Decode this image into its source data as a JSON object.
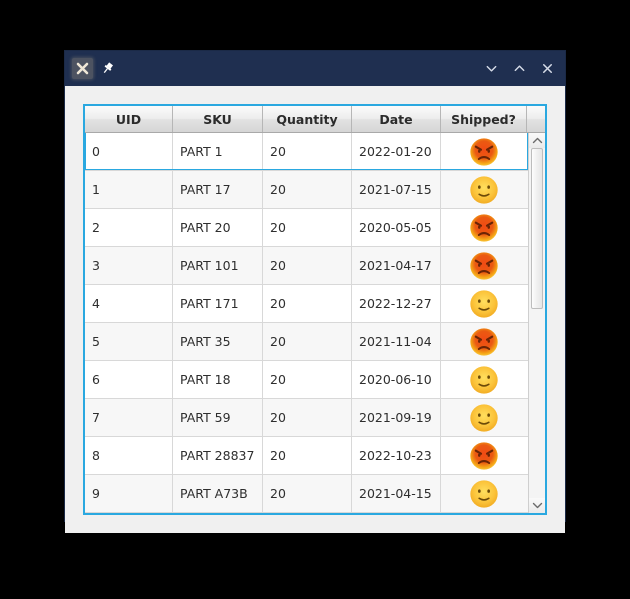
{
  "window": {
    "titlebar": {
      "left_buttons": [
        {
          "name": "close-icon",
          "label": "✖",
          "hovered": true
        },
        {
          "name": "pin-icon",
          "label": "📌",
          "hovered": false
        }
      ],
      "right_controls": [
        {
          "name": "minimize-icon",
          "label": "∨"
        },
        {
          "name": "maximize-icon",
          "label": "∧"
        },
        {
          "name": "close-window-icon",
          "label": "✕"
        }
      ]
    }
  },
  "table": {
    "columns": [
      {
        "key": "uid",
        "label": "UID"
      },
      {
        "key": "sku",
        "label": "SKU"
      },
      {
        "key": "quantity",
        "label": "Quantity"
      },
      {
        "key": "date",
        "label": "Date"
      },
      {
        "key": "shipped",
        "label": "Shipped?"
      }
    ],
    "selected_row_index": 0,
    "rows": [
      {
        "uid": "0",
        "sku": "PART 1",
        "quantity": "20",
        "date": "2022-01-20",
        "shipped": "angry-face-icon"
      },
      {
        "uid": "1",
        "sku": "PART 17",
        "quantity": "20",
        "date": "2021-07-15",
        "shipped": "slight-smile-face-icon"
      },
      {
        "uid": "2",
        "sku": "PART 20",
        "quantity": "20",
        "date": "2020-05-05",
        "shipped": "angry-face-icon"
      },
      {
        "uid": "3",
        "sku": "PART 101",
        "quantity": "20",
        "date": "2021-04-17",
        "shipped": "angry-face-icon"
      },
      {
        "uid": "4",
        "sku": "PART 171",
        "quantity": "20",
        "date": "2022-12-27",
        "shipped": "slight-smile-face-icon"
      },
      {
        "uid": "5",
        "sku": "PART 35",
        "quantity": "20",
        "date": "2021-11-04",
        "shipped": "angry-face-icon"
      },
      {
        "uid": "6",
        "sku": "PART 18",
        "quantity": "20",
        "date": "2020-06-10",
        "shipped": "slight-smile-face-icon"
      },
      {
        "uid": "7",
        "sku": "PART 59",
        "quantity": "20",
        "date": "2021-09-19",
        "shipped": "slight-smile-face-icon"
      },
      {
        "uid": "8",
        "sku": "PART 28837",
        "quantity": "20",
        "date": "2022-10-23",
        "shipped": "angry-face-icon"
      },
      {
        "uid": "9",
        "sku": "PART A73B",
        "quantity": "20",
        "date": "2021-04-15",
        "shipped": "slight-smile-face-icon"
      }
    ]
  },
  "scrollbar": {
    "up_arrow": "∧",
    "down_arrow": "∨",
    "thumb_top_percent": 0,
    "thumb_height_percent": 46
  },
  "colors": {
    "titlebar": "#1f2f50",
    "window_bg": "#f0f0f0",
    "table_border": "#2aa8e0",
    "selection_border": "#2aa8e0",
    "row_even": "#ffffff",
    "row_odd": "#f7f7f7",
    "desktop": "#000000"
  }
}
